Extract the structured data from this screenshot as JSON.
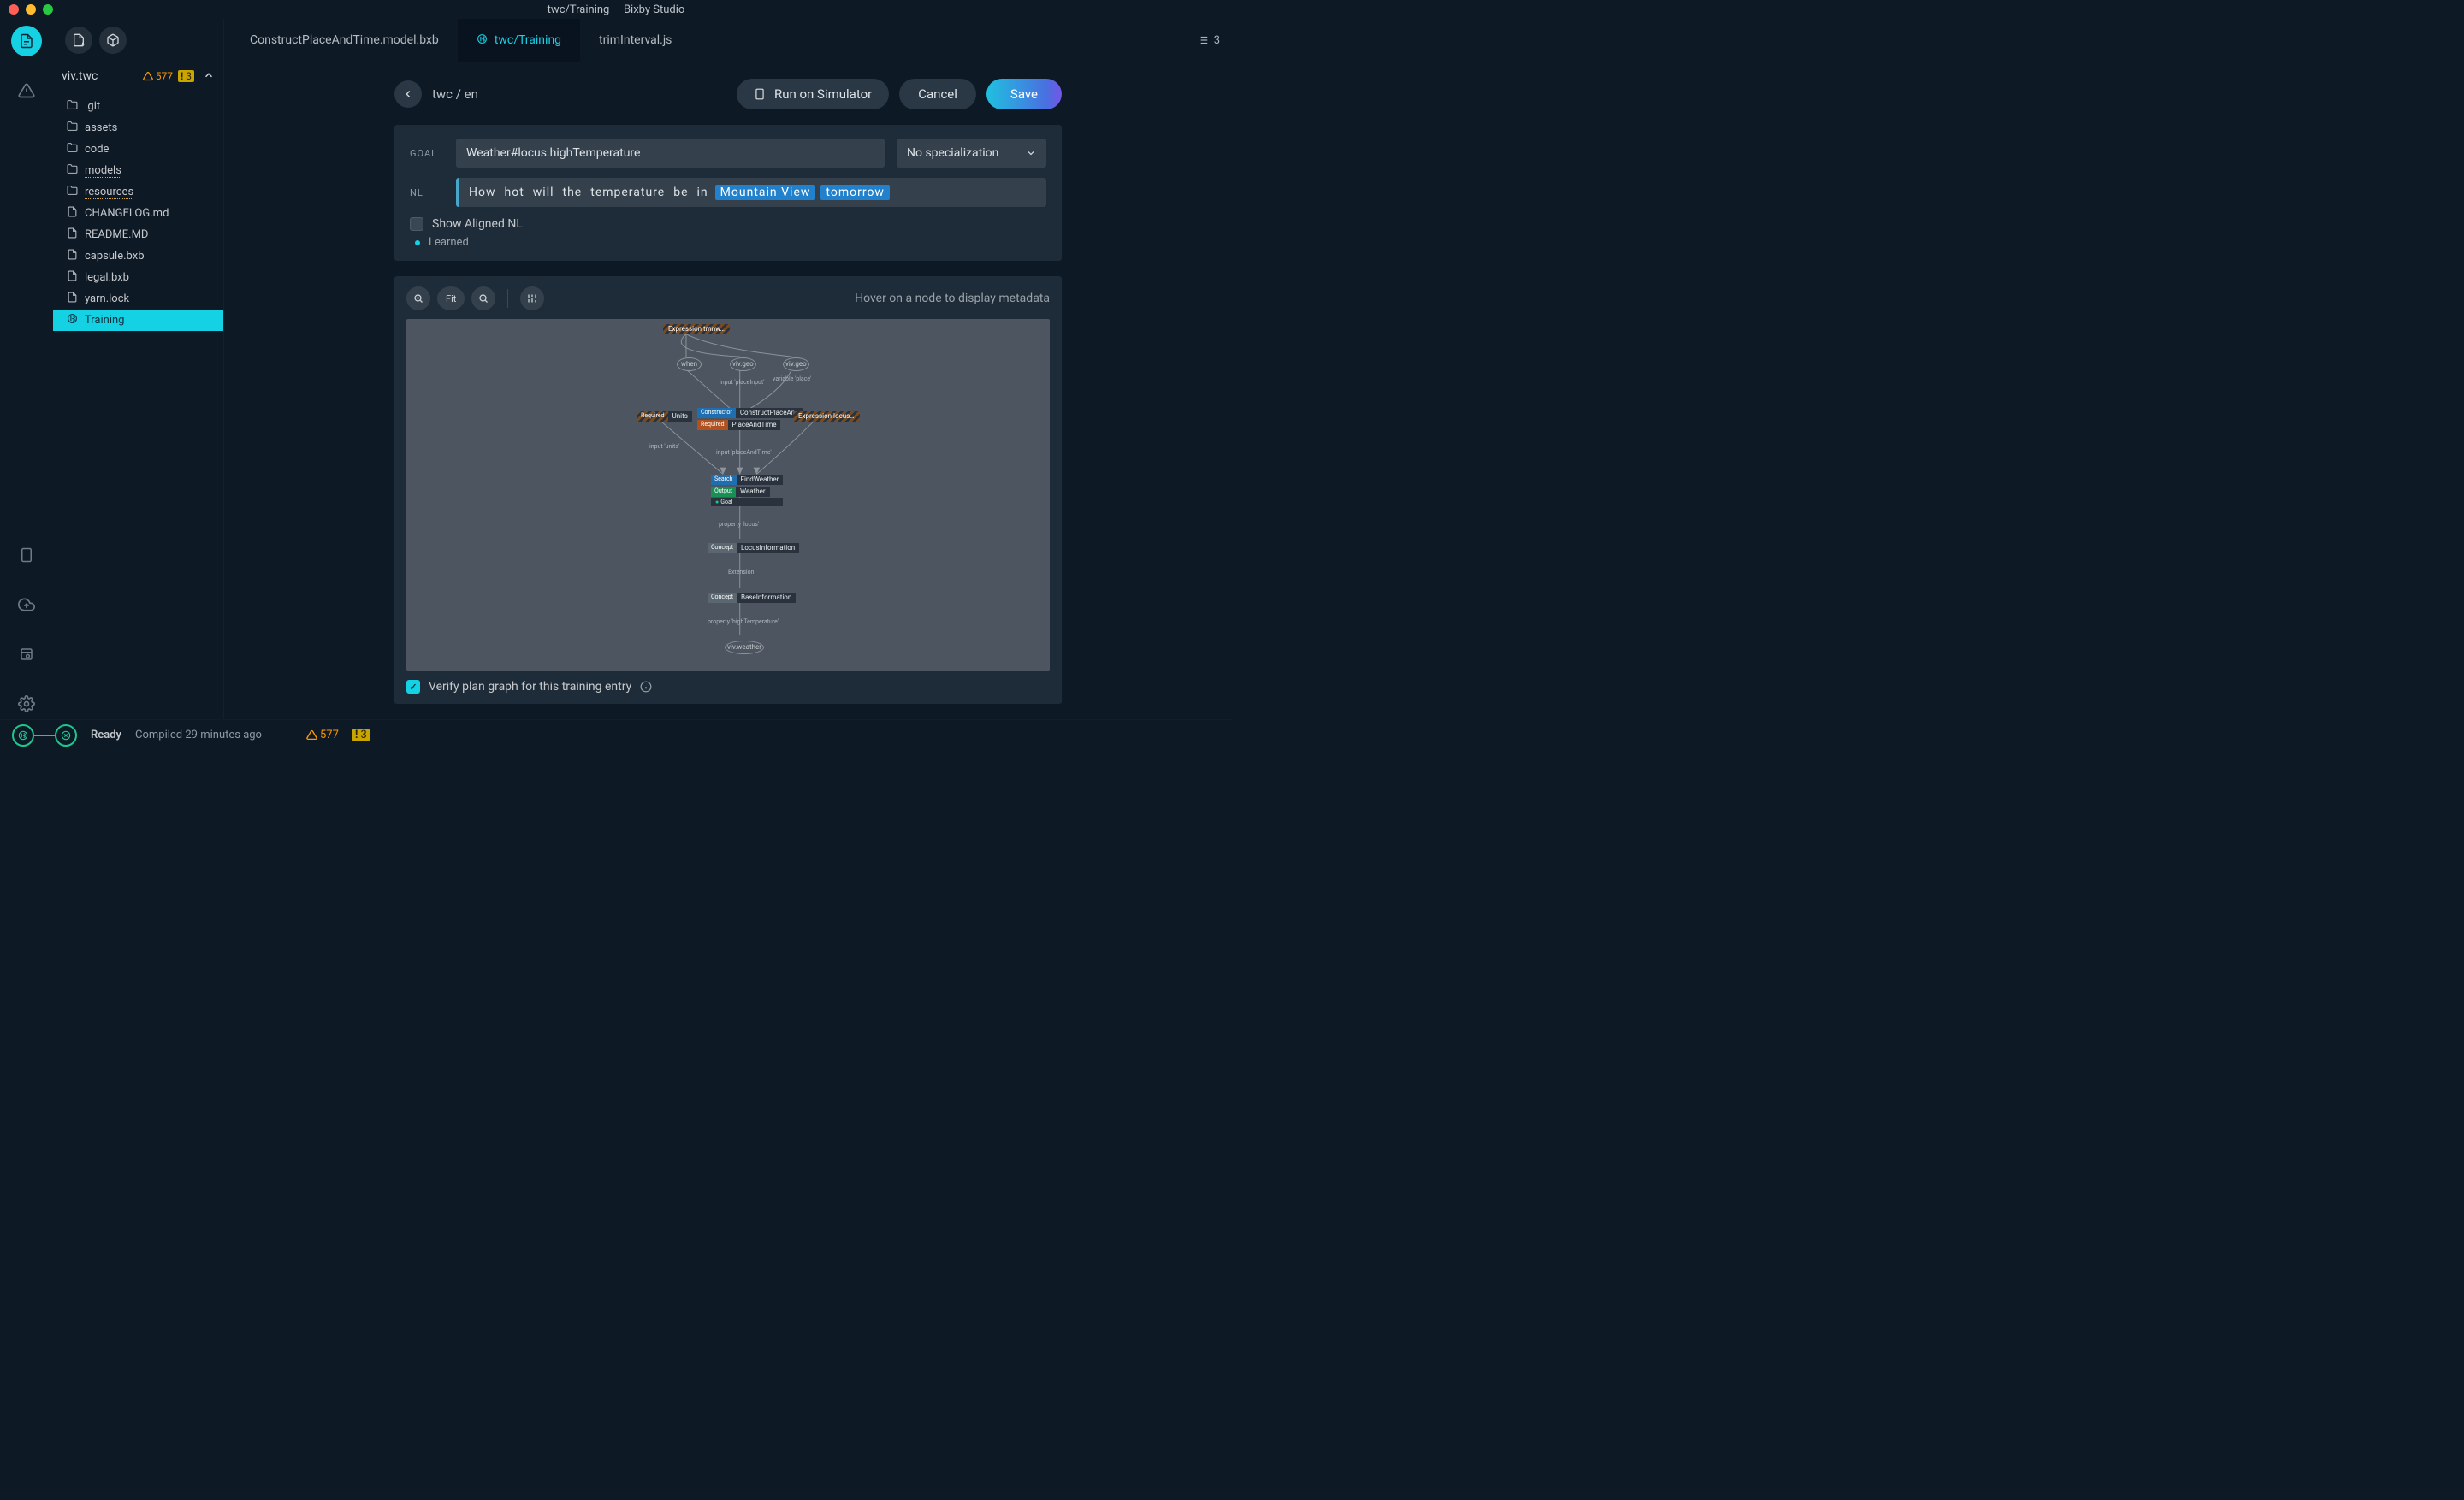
{
  "window": {
    "title": "twc/Training — Bixby Studio"
  },
  "rail": {
    "warning_icon": "alert-triangle"
  },
  "sidebar": {
    "capsule_name": "viv.twc",
    "warn_count": "577",
    "err_count": "3",
    "tree": [
      {
        "icon": "folder",
        "label": ".git"
      },
      {
        "icon": "folder",
        "label": "assets"
      },
      {
        "icon": "folder",
        "label": "code"
      },
      {
        "icon": "folder",
        "label": "models",
        "dotted": true
      },
      {
        "icon": "folder",
        "label": "resources",
        "dotted": true
      },
      {
        "icon": "file",
        "label": "CHANGELOG.md"
      },
      {
        "icon": "file",
        "label": "README.MD"
      },
      {
        "icon": "file",
        "label": "capsule.bxb",
        "dotted": true
      },
      {
        "icon": "file",
        "label": "legal.bxb"
      },
      {
        "icon": "file",
        "label": "yarn.lock"
      },
      {
        "icon": "bixby",
        "label": "Training",
        "selected": true
      }
    ]
  },
  "tabs": {
    "list": [
      {
        "label": "ConstructPlaceAndTime.model.bxb"
      },
      {
        "label": "twc/Training",
        "active": true,
        "icon": "bixby"
      },
      {
        "label": "trimInterval.js"
      }
    ],
    "right_num": "3"
  },
  "toolbar": {
    "breadcrumb": "twc / en",
    "run_label": "Run on Simulator",
    "cancel_label": "Cancel",
    "save_label": "Save"
  },
  "training": {
    "goal_label": "GOAL",
    "goal_value": "Weather#locus.highTemperature",
    "spec_label": "No specialization",
    "nl_label": "NL",
    "nl_tokens": [
      {
        "t": "How"
      },
      {
        "t": "hot"
      },
      {
        "t": "will"
      },
      {
        "t": "the"
      },
      {
        "t": "temperature"
      },
      {
        "t": "be"
      },
      {
        "t": "in"
      },
      {
        "t": "Mountain View",
        "hl": true
      },
      {
        "t": "tomorrow",
        "hl": true
      }
    ],
    "show_aligned_label": "Show Aligned NL",
    "show_aligned_checked": false,
    "learned_label": "Learned"
  },
  "graph": {
    "fit_label": "Fit",
    "hint": "Hover on a node to display metadata",
    "verify_label": "Verify plan graph for this training entry",
    "verify_checked": true,
    "nodes": {
      "expression": "Expression  tmnw…",
      "when": "when",
      "vivgeo1": "viv.geo",
      "vivgeo2": "viv.geo",
      "inp_placeInput": "input 'placeInput'",
      "var_place": "variable 'place'",
      "units_tag": "Required",
      "units_name": "Units",
      "constr_tag": "Constructor",
      "constr_name": "ConstructPlaceAn…",
      "req_tag": "Required",
      "req_name": "PlaceAndTime",
      "expr2": "Expression  locus…",
      "inp_units": "input 'units'",
      "inp_placeAndTime": "input 'placeAndTime'",
      "search_tag": "Search",
      "search_name": "FindWeather",
      "out_tag": "Output",
      "out_name": "Weather",
      "goal_text": "Goal",
      "prop_locus": "property 'locus'",
      "concept_tag": "Concept",
      "locusinfo": "LocusInformation",
      "extension": "Extension",
      "baseinfo": "BaseInformation",
      "prop_high": "property 'highTemperature'",
      "vivweather": "viv.weather"
    }
  },
  "status": {
    "ready": "Ready",
    "compiled": "Compiled 29 minutes ago",
    "warn_count": "577",
    "err_count": "3"
  }
}
